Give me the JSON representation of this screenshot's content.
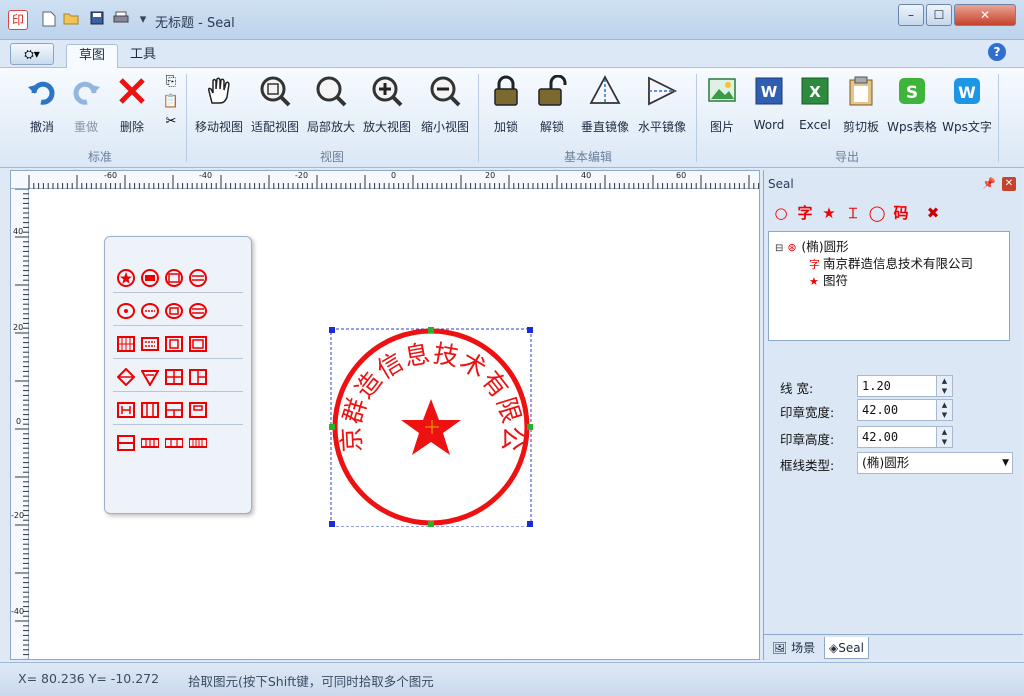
{
  "window": {
    "title": "无标题 - Seal",
    "app_icon": "seal-app-icon",
    "quick_access": [
      "new-document-icon",
      "open-folder-icon",
      "save-disk-icon",
      "print-icon",
      "customize-dropdown-icon"
    ],
    "controls": [
      "minimize-icon",
      "maximize-icon",
      "close-icon"
    ]
  },
  "ribbon": {
    "tabs": [
      {
        "label": "草图",
        "active": true
      },
      {
        "label": "工具",
        "active": false
      }
    ],
    "groups": [
      {
        "label": "标准",
        "buttons": [
          {
            "label": "撤消",
            "icon": "undo-icon",
            "enabled": true
          },
          {
            "label": "重做",
            "icon": "redo-icon",
            "enabled": false
          },
          {
            "label": "删除",
            "icon": "delete-icon",
            "enabled": true
          }
        ],
        "small_buttons": [
          "copy-icon",
          "paste-icon",
          "cut-icon"
        ]
      },
      {
        "label": "视图",
        "buttons": [
          {
            "label": "移动视图",
            "icon": "hand-pan-icon"
          },
          {
            "label": "适配视图",
            "icon": "zoom-fit-icon"
          },
          {
            "label": "局部放大",
            "icon": "zoom-area-icon"
          },
          {
            "label": "放大视图",
            "icon": "zoom-in-icon"
          },
          {
            "label": "缩小视图",
            "icon": "zoom-out-icon"
          }
        ]
      },
      {
        "label": "基本编辑",
        "buttons": [
          {
            "label": "加锁",
            "icon": "lock-icon"
          },
          {
            "label": "解锁",
            "icon": "unlock-icon"
          },
          {
            "label": "垂直镜像",
            "icon": "vertical-mirror-icon"
          },
          {
            "label": "水平镜像",
            "icon": "horizontal-mirror-icon"
          }
        ]
      },
      {
        "label": "导出",
        "buttons": [
          {
            "label": "图片",
            "icon": "image-export-icon"
          },
          {
            "label": "Word",
            "icon": "word-icon"
          },
          {
            "label": "Excel",
            "icon": "excel-icon"
          },
          {
            "label": "剪切板",
            "icon": "clipboard-icon"
          },
          {
            "label": "Wps表格",
            "icon": "wps-sheet-icon"
          },
          {
            "label": "Wps文字",
            "icon": "wps-writer-icon"
          }
        ]
      }
    ]
  },
  "ruler": {
    "top_labels": [
      "-60",
      "-40",
      "-20",
      "0",
      "20",
      "40",
      "60"
    ],
    "left_labels": [
      "40",
      "20",
      "0",
      "-20",
      "-40"
    ]
  },
  "seal": {
    "company": "南京群造信息技术有限公司",
    "color": "#ee1111"
  },
  "panel": {
    "title": "Seal",
    "toolbar": [
      "circle-icon",
      "text-icon",
      "star-icon",
      "line-icon",
      "ring-icon",
      "code-icon",
      "delete-icon"
    ],
    "tree": {
      "root": "(椭)圆形",
      "children": [
        "南京群造信息技术有限公司",
        "图符"
      ]
    },
    "properties": [
      {
        "label": "线    宽:",
        "value": "1.20"
      },
      {
        "label": "印章宽度:",
        "value": "42.00"
      },
      {
        "label": "印章高度:",
        "value": "42.00"
      },
      {
        "label": "框线类型:",
        "value": "(椭)圆形"
      }
    ],
    "tabs": [
      {
        "label": "场景",
        "active": false
      },
      {
        "label": "Seal",
        "active": true
      }
    ]
  },
  "status": {
    "coords": "X=  80.236 Y= -10.272",
    "hint": "拾取图元(按下Shift键，可同时拾取多个图元"
  }
}
